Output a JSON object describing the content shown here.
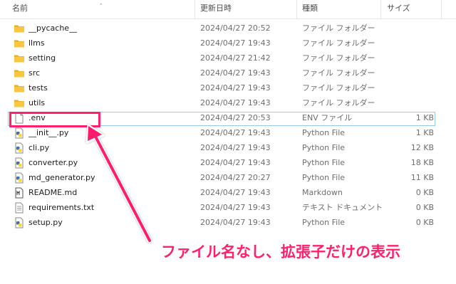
{
  "columns": {
    "name": "名前",
    "modified": "更新日時",
    "type": "種類",
    "size": "サイズ"
  },
  "rows": [
    {
      "name": "__pycache__",
      "modified": "2024/04/27 20:52",
      "type": "ファイル フォルダー",
      "size": "",
      "icon": "folder-icon"
    },
    {
      "name": "llms",
      "modified": "2024/04/27 19:43",
      "type": "ファイル フォルダー",
      "size": "",
      "icon": "folder-icon"
    },
    {
      "name": "setting",
      "modified": "2024/04/27 21:42",
      "type": "ファイル フォルダー",
      "size": "",
      "icon": "folder-icon"
    },
    {
      "name": "src",
      "modified": "2024/04/27 19:43",
      "type": "ファイル フォルダー",
      "size": "",
      "icon": "folder-icon"
    },
    {
      "name": "tests",
      "modified": "2024/04/27 19:43",
      "type": "ファイル フォルダー",
      "size": "",
      "icon": "folder-icon"
    },
    {
      "name": "utils",
      "modified": "2024/04/27 19:43",
      "type": "ファイル フォルダー",
      "size": "",
      "icon": "folder-icon"
    },
    {
      "name": ".env",
      "modified": "2024/04/27 20:53",
      "type": "ENV ファイル",
      "size": "1 KB",
      "icon": "blank-file-icon"
    },
    {
      "name": "__init__.py",
      "modified": "2024/04/27 19:43",
      "type": "Python File",
      "size": "1 KB",
      "icon": "python-file-icon"
    },
    {
      "name": "cli.py",
      "modified": "2024/04/27 19:43",
      "type": "Python File",
      "size": "12 KB",
      "icon": "python-file-icon"
    },
    {
      "name": "converter.py",
      "modified": "2024/04/27 19:43",
      "type": "Python File",
      "size": "18 KB",
      "icon": "python-file-icon"
    },
    {
      "name": "md_generator.py",
      "modified": "2024/04/27 20:27",
      "type": "Python File",
      "size": "11 KB",
      "icon": "python-file-icon"
    },
    {
      "name": "README.md",
      "modified": "2024/04/27 19:43",
      "type": "Markdown",
      "size": "0 KB",
      "icon": "markdown-file-icon"
    },
    {
      "name": "requirements.txt",
      "modified": "2024/04/27 19:43",
      "type": "テキスト ドキュメント",
      "size": "0 KB",
      "icon": "text-file-icon"
    },
    {
      "name": "setup.py",
      "modified": "2024/04/27 19:43",
      "type": "Python File",
      "size": "0 KB",
      "icon": "python-file-icon"
    }
  ],
  "annotation": {
    "text": "ファイル名なし、拡張子だけの表示",
    "color": "#ff1f6d"
  },
  "colors": {
    "folder": "#f8c642",
    "highlight": "#ff1f6d",
    "python_blue": "#3776ab",
    "python_yellow": "#ffd43b"
  }
}
